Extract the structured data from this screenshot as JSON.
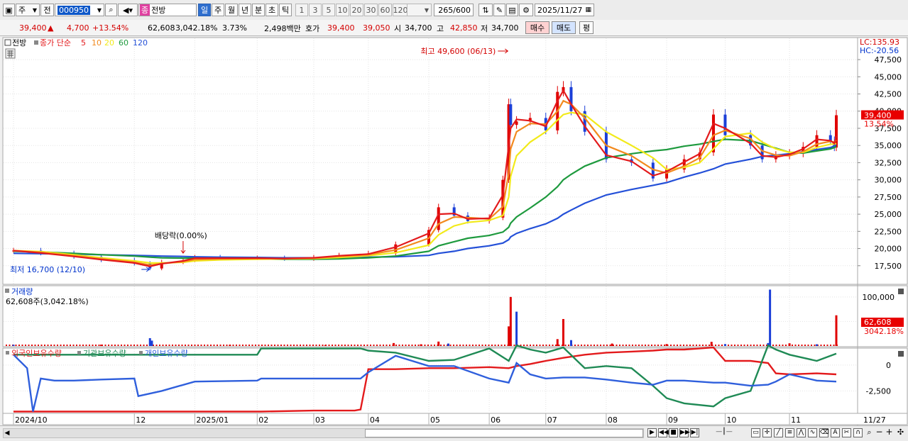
{
  "toolbar": {
    "market_tab": "주",
    "all_tab": "전",
    "stock_code": "000950",
    "stock_badge": "종",
    "stock_name": "전방",
    "periods": [
      "일",
      "주",
      "월",
      "년",
      "분",
      "초",
      "틱"
    ],
    "minute_options": [
      "1",
      "3",
      "5",
      "10",
      "20",
      "30",
      "60",
      "120"
    ],
    "count": "265",
    "count_total": "/600",
    "date": "2025/11/27"
  },
  "quote": {
    "price": "39,400",
    "change_arrow": "▲",
    "change": "4,700",
    "change_pct": "+13.54%",
    "volume": "62,608",
    "volume_pct": "3,042.18%",
    "turnover": "3.73%",
    "amount": "2,498백만",
    "ask_label": "호가",
    "ask1": "39,400",
    "ask2": "39,050",
    "open_label": "시",
    "open": "34,700",
    "high_label": "고",
    "high": "42,850",
    "low_label": "저",
    "low": "34,700",
    "buy_label": "매수",
    "sell_label": "매도",
    "eval_label": "평"
  },
  "colors": {
    "up": "#e00000",
    "down": "#1b3fd8",
    "ma5": "#e31a1c",
    "ma10": "#f28a1e",
    "ma20": "#f2ea1a",
    "ma60": "#1e9a3e",
    "ma120": "#2450d8",
    "foreign": "#e31a1c",
    "institution": "#1f8a55",
    "individual": "#2f5fdc"
  },
  "chart_data": [
    {
      "type": "line",
      "panel": "price",
      "title": "전방",
      "legend": [
        "종가 단순",
        "5",
        "10",
        "20",
        "60",
        "120"
      ],
      "lc_label": "LC:135.93",
      "hc_label": "HC:-20.56",
      "yticks": [
        17500,
        20000,
        22500,
        25000,
        27500,
        30000,
        32500,
        35000,
        37500,
        40000,
        42500,
        45000,
        47500
      ],
      "ytick_labels": [
        "17,500",
        "20,000",
        "22,500",
        "25,000",
        "27,500",
        "30,000",
        "32,500",
        "35,000",
        "37,500",
        "40,000",
        "42,500",
        "45,000",
        "47,500"
      ],
      "ylim": [
        15000,
        50500
      ],
      "current_price_label": "39,400",
      "current_pct_label": "13.54%",
      "high_annotation": "최고 49,600 (06/13)",
      "low_annotation": "최저 16,700 (12/10)",
      "dividend_annotation": "배당락(0.00%)",
      "xticks": [
        "2024/10",
        "12",
        "2025/01",
        "02",
        "03",
        "04",
        "05",
        "06",
        "07",
        "08",
        "09",
        "10",
        "11",
        "11/27"
      ],
      "x": [
        "2024-10-01",
        "2024-10-15",
        "2024-11-01",
        "2024-11-15",
        "2024-12-02",
        "2024-12-10",
        "2024-12-16",
        "2024-12-27",
        "2025-01-02",
        "2025-01-15",
        "2025-02-03",
        "2025-02-17",
        "2025-03-04",
        "2025-03-17",
        "2025-04-01",
        "2025-04-15",
        "2025-05-02",
        "2025-05-07",
        "2025-05-15",
        "2025-05-22",
        "2025-06-02",
        "2025-06-09",
        "2025-06-12",
        "2025-06-13",
        "2025-06-16",
        "2025-06-23",
        "2025-07-01",
        "2025-07-07",
        "2025-07-10",
        "2025-07-14",
        "2025-07-21",
        "2025-08-01",
        "2025-08-14",
        "2025-08-25",
        "2025-09-01",
        "2025-09-10",
        "2025-09-18",
        "2025-09-25",
        "2025-10-01",
        "2025-10-14",
        "2025-10-20",
        "2025-10-27",
        "2025-11-03",
        "2025-11-10",
        "2025-11-17",
        "2025-11-24",
        "2025-11-26",
        "2025-11-27"
      ],
      "series": [
        {
          "name": "종가",
          "values": [
            19700,
            19300,
            18800,
            18300,
            17800,
            17100,
            18000,
            18300,
            18700,
            18600,
            18600,
            18500,
            18700,
            19000,
            19300,
            20600,
            22700,
            26000,
            24800,
            24000,
            24500,
            30000,
            41000,
            38000,
            38500,
            39000,
            37200,
            42800,
            43500,
            40000,
            37000,
            33000,
            32500,
            30200,
            31500,
            33000,
            34000,
            39500,
            36500,
            35000,
            33000,
            33500,
            33800,
            34800,
            36500,
            35600,
            34700,
            39400
          ]
        },
        {
          "name": "5",
          "values": [
            19700,
            19350,
            18850,
            18400,
            17900,
            17400,
            17800,
            18200,
            18600,
            18600,
            18600,
            18550,
            18650,
            18950,
            19200,
            20200,
            22200,
            25000,
            25100,
            24300,
            24400,
            27800,
            35000,
            37500,
            38800,
            38600,
            37800,
            41500,
            43000,
            41000,
            37800,
            33600,
            32700,
            30600,
            31200,
            32600,
            33800,
            38200,
            37500,
            35300,
            33500,
            33300,
            33700,
            34500,
            35900,
            35700,
            35300,
            36400
          ]
        },
        {
          "name": "10",
          "values": [
            19700,
            19450,
            18950,
            18500,
            18000,
            17600,
            17800,
            18100,
            18400,
            18500,
            18550,
            18550,
            18600,
            18850,
            19100,
            19800,
            21500,
            23600,
            24600,
            24500,
            24300,
            26100,
            31000,
            34500,
            37000,
            38200,
            38100,
            40000,
            41500,
            41000,
            39000,
            35000,
            33500,
            31500,
            31000,
            32000,
            33200,
            36500,
            37200,
            36000,
            34200,
            33600,
            33500,
            34100,
            35200,
            35600,
            35500,
            35800
          ]
        },
        {
          "name": "20",
          "values": [
            19700,
            19550,
            19100,
            18650,
            18200,
            17900,
            17900,
            18000,
            18200,
            18350,
            18450,
            18500,
            18550,
            18700,
            18950,
            19400,
            20500,
            22000,
            23300,
            23800,
            24100,
            24800,
            27500,
            30500,
            33500,
            35500,
            37000,
            38700,
            39500,
            39800,
            39500,
            37000,
            35000,
            33200,
            31500,
            31800,
            32500,
            34500,
            36300,
            36800,
            35500,
            34500,
            34000,
            34000,
            34700,
            35200,
            35200,
            35300
          ]
        },
        {
          "name": "60",
          "values": [
            19600,
            19500,
            19300,
            19100,
            18900,
            18750,
            18650,
            18600,
            18600,
            18500,
            18500,
            18450,
            18450,
            18500,
            18650,
            18900,
            19600,
            20400,
            21000,
            21500,
            21900,
            22400,
            23100,
            23700,
            24600,
            25900,
            27500,
            29000,
            30000,
            30800,
            32000,
            33200,
            33800,
            34200,
            34400,
            34900,
            35200,
            35600,
            35900,
            35700,
            35200,
            34600,
            34000,
            33900,
            34200,
            34500,
            34700,
            34900
          ]
        },
        {
          "name": "120",
          "values": [
            19300,
            19250,
            19200,
            19100,
            19000,
            18950,
            18900,
            18850,
            18800,
            18750,
            18700,
            18650,
            18650,
            18700,
            18750,
            18800,
            19000,
            19300,
            19600,
            20000,
            20400,
            20800,
            21300,
            21700,
            22200,
            22900,
            23600,
            24400,
            25000,
            25600,
            26600,
            27800,
            28600,
            29200,
            29600,
            30400,
            31000,
            31600,
            32300,
            33000,
            33400,
            33600,
            33800,
            34100,
            34400,
            34700,
            34900,
            35100
          ]
        }
      ]
    },
    {
      "type": "bar",
      "panel": "volume",
      "title": "거래량",
      "value_label": "62,608주(3,042.18%)",
      "yticks": [
        50000,
        100000
      ],
      "ytick_labels": [
        "50,000",
        "100,000"
      ],
      "ylim": [
        0,
        120000
      ],
      "current_label": "62,608",
      "current_pct_label": "3042.18%",
      "x": [
        "2024-10-01",
        "2024-11-15",
        "2024-12-10",
        "2024-12-11",
        "2025-01-20",
        "2025-03-10",
        "2025-04-14",
        "2025-04-28",
        "2025-05-07",
        "2025-05-12",
        "2025-06-12",
        "2025-06-13",
        "2025-06-16",
        "2025-07-07",
        "2025-07-10",
        "2025-07-14",
        "2025-08-04",
        "2025-09-01",
        "2025-09-24",
        "2025-10-01",
        "2025-10-23",
        "2025-10-24",
        "2025-11-03",
        "2025-11-17",
        "2025-11-27"
      ],
      "values": [
        2500,
        2800,
        16000,
        11000,
        2500,
        2000,
        6000,
        3500,
        9000,
        5000,
        40000,
        100000,
        70000,
        14000,
        55000,
        12000,
        5000,
        4000,
        8500,
        4000,
        6000,
        115000,
        5500,
        3500,
        62608
      ]
    },
    {
      "type": "line",
      "panel": "holdings",
      "legend": [
        "외국인보유수량",
        "기관보유수량",
        "개인보유수량"
      ],
      "yticks": [
        0,
        -2500
      ],
      "ytick_labels": [
        "0",
        "-2,500"
      ],
      "ylim": [
        -4600,
        1500
      ],
      "x": [
        "2024-10-01",
        "2024-10-08",
        "2024-10-11",
        "2024-10-15",
        "2024-10-22",
        "2024-11-01",
        "2024-11-15",
        "2024-12-02",
        "2024-12-04",
        "2024-12-16",
        "2025-01-02",
        "2025-02-03",
        "2025-02-05",
        "2025-03-04",
        "2025-03-25",
        "2025-03-28",
        "2025-04-01",
        "2025-04-15",
        "2025-05-02",
        "2025-05-15",
        "2025-06-02",
        "2025-06-12",
        "2025-06-16",
        "2025-06-23",
        "2025-07-01",
        "2025-07-10",
        "2025-07-21",
        "2025-08-01",
        "2025-08-14",
        "2025-08-25",
        "2025-09-01",
        "2025-09-10",
        "2025-09-25",
        "2025-10-01",
        "2025-10-14",
        "2025-10-23",
        "2025-10-27",
        "2025-11-03",
        "2025-11-17",
        "2025-11-27"
      ],
      "series": [
        {
          "name": "외국인보유수량",
          "values": [
            -4500,
            -4500,
            -4500,
            -4500,
            -4500,
            -4500,
            -4500,
            -4500,
            -4500,
            -4500,
            -4500,
            -4500,
            -4500,
            -4400,
            -4400,
            -4300,
            -400,
            -400,
            -300,
            -300,
            -200,
            -300,
            -100,
            100,
            400,
            700,
            1000,
            1200,
            1300,
            1400,
            1500,
            1500,
            1700,
            400,
            400,
            200,
            -800,
            -900,
            -800,
            -900
          ]
        },
        {
          "name": "기관보유수량",
          "values": [
            1000,
            1000,
            1000,
            1000,
            1000,
            1000,
            1000,
            1000,
            1000,
            1000,
            1000,
            1000,
            1600,
            1600,
            1600,
            1600,
            1400,
            1200,
            400,
            500,
            1600,
            400,
            1900,
            1500,
            1200,
            1700,
            -300,
            -100,
            -300,
            -2000,
            -3200,
            -3700,
            -4000,
            -3200,
            -2500,
            1900,
            1500,
            1000,
            400,
            1100
          ]
        },
        {
          "name": "개인보유수량",
          "values": [
            1000,
            -300,
            -4500,
            -1300,
            -1500,
            -1500,
            -1400,
            -1300,
            -3000,
            -2500,
            -1600,
            -1500,
            -1300,
            -1300,
            -1300,
            -1300,
            -700,
            900,
            -100,
            -100,
            -1300,
            -1700,
            200,
            -900,
            -1300,
            -1200,
            -1200,
            -1400,
            -1700,
            -1900,
            -1500,
            -1500,
            -1700,
            -1700,
            -2000,
            -1900,
            -1600,
            -900,
            -1500,
            -1600
          ]
        }
      ]
    }
  ]
}
